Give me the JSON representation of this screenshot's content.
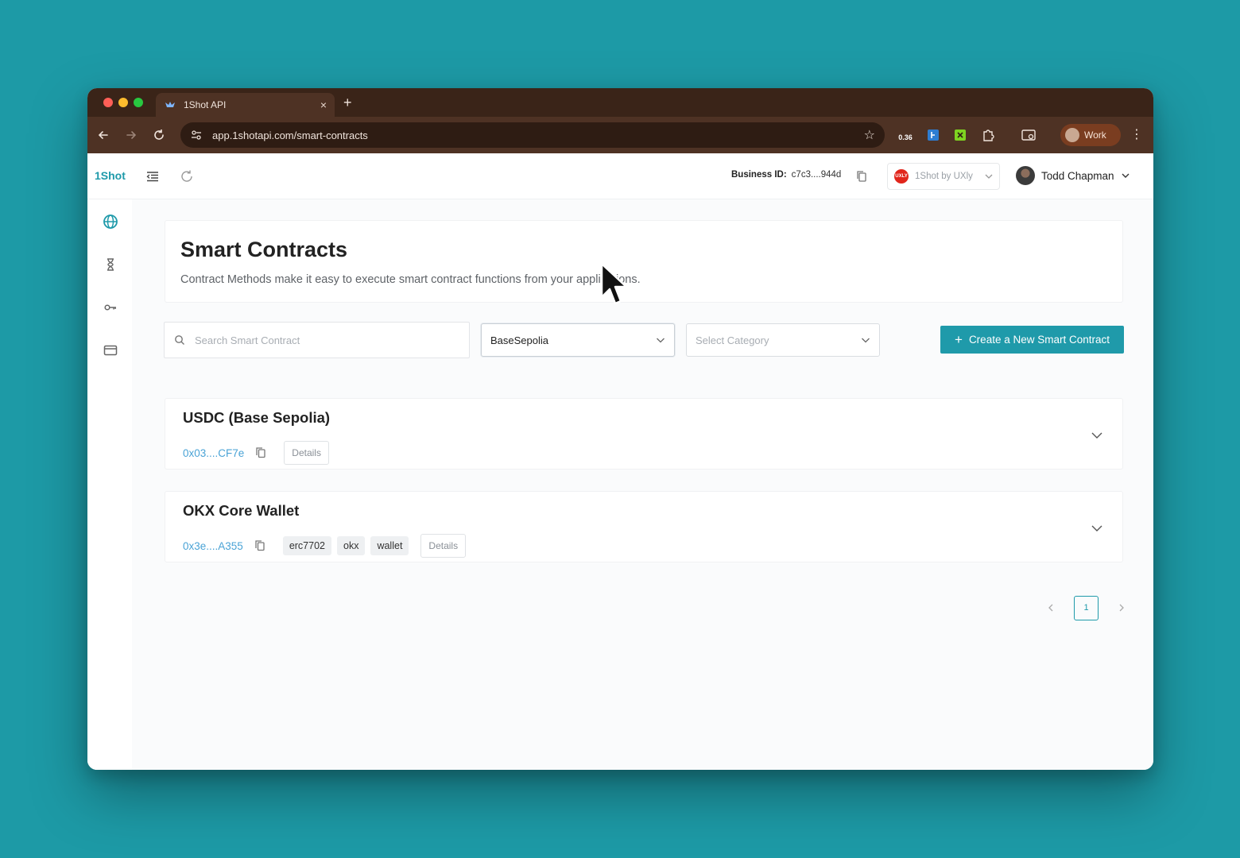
{
  "browser": {
    "tab": {
      "title": "1Shot API",
      "close_label": "×"
    },
    "new_tab_label": "+",
    "url": "app.1shotapi.com/smart-contracts",
    "extension_badge": "0.36",
    "profile_label": "Work",
    "menu_label": "⋮"
  },
  "header": {
    "logo": "1Shot",
    "business_id_label": "Business ID:",
    "business_id_value": "c7c3....944d",
    "org_name": "1Shot by UXly",
    "org_avatar_text": "UXLY",
    "user_name": "Todd Chapman"
  },
  "sidebar": {
    "items": [
      {
        "icon": "globe-icon",
        "active": true
      },
      {
        "icon": "hourglass-icon",
        "active": false
      },
      {
        "icon": "key-icon",
        "active": false
      },
      {
        "icon": "wallet-icon",
        "active": false
      }
    ]
  },
  "page": {
    "title": "Smart Contracts",
    "subtitle": "Contract Methods make it easy to execute smart contract functions from your applications."
  },
  "filters": {
    "search_placeholder": "Search Smart Contract",
    "network_value": "BaseSepolia",
    "category_placeholder": "Select Category",
    "create_label": "Create a New Smart Contract"
  },
  "contracts": [
    {
      "name": "USDC (Base Sepolia)",
      "address": "0x03....CF7e",
      "tags": [],
      "details_label": "Details"
    },
    {
      "name": "OKX Core Wallet",
      "address": "0x3e....A355",
      "tags": [
        "erc7702",
        "okx",
        "wallet"
      ],
      "details_label": "Details"
    }
  ],
  "pagination": {
    "current_page": "1"
  },
  "colors": {
    "accent": "#1f9aaa",
    "link": "#4aa3d6",
    "background": "#1d9aa6"
  }
}
